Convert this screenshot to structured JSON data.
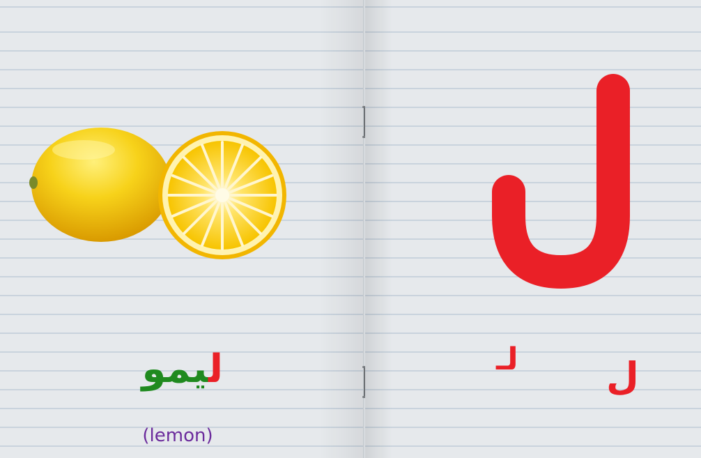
{
  "left_page": {
    "word_first_letter": "ل",
    "word_rest": "یمو",
    "translation": "(lemon)",
    "illustration": "lemon-whole-and-half"
  },
  "right_page": {
    "big_letter": "ل",
    "initial_form": "لـ",
    "isolated_form": "ل",
    "letter_color": "#ea2027"
  },
  "colors": {
    "word_first": "#ea2027",
    "word_rest": "#1f8a1f",
    "translation": "#6b2b9c",
    "lemon": "#f5c400"
  }
}
